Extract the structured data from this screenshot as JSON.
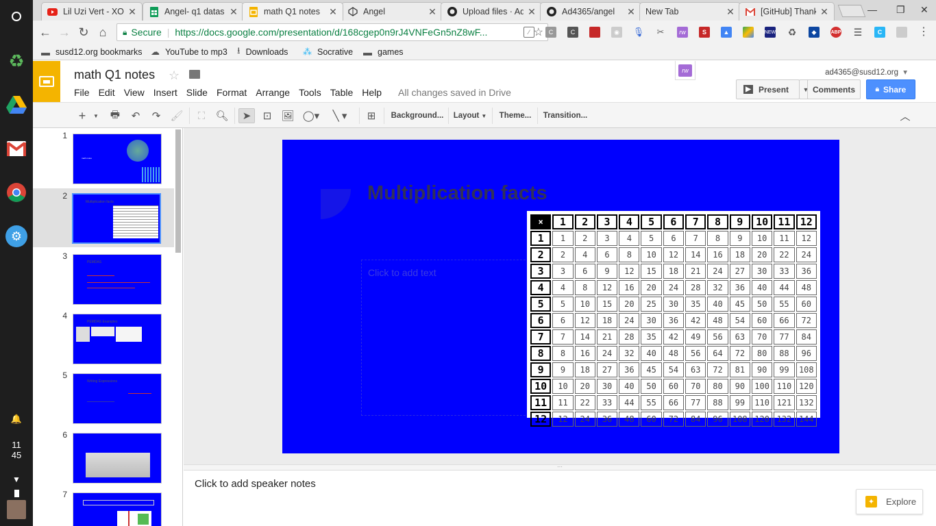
{
  "browser": {
    "tabs": [
      {
        "title": "Lil Uzi Vert - XO",
        "icon": "youtube-icon",
        "active": false
      },
      {
        "title": "Angel- q1 datas",
        "icon": "sheets-icon",
        "active": false
      },
      {
        "title": "math Q1 notes",
        "icon": "slides-icon",
        "active": true
      },
      {
        "title": "Angel",
        "icon": "codepen-icon",
        "active": false
      },
      {
        "title": "Upload files · Ad",
        "icon": "github-icon",
        "active": false
      },
      {
        "title": "Ad4365/angel",
        "icon": "github-icon",
        "active": false
      },
      {
        "title": "New Tab",
        "icon": "",
        "active": false
      },
      {
        "title": "[GitHub] Thanks",
        "icon": "gmail-icon",
        "active": false
      }
    ],
    "secure_label": "Secure",
    "url": "https://docs.google.com/presentation/d/168cgep0n9rJ4VNFeGn5nZ8wF...",
    "bookmarks": [
      {
        "label": "susd12.org bookmarks",
        "icon": "folder-icon"
      },
      {
        "label": "YouTube to mp3",
        "icon": "cloud-download-icon"
      },
      {
        "label": "Downloads",
        "icon": "download-icon"
      },
      {
        "label": "Socrative",
        "icon": "socrative-icon"
      },
      {
        "label": "games",
        "icon": "folder-icon"
      }
    ],
    "extensions": [
      "color-picker",
      "c-gray",
      "c-dark",
      "red-book",
      "camera",
      "mic",
      "scissors",
      "rw",
      "s-red",
      "drive-multi",
      "colors-stripe",
      "new-badge",
      "recycle",
      "shield-blue",
      "abp",
      "list",
      "c-blue",
      "puzzle-gray"
    ]
  },
  "shelf": {
    "clock_hour": "11",
    "clock_min": "45"
  },
  "docs": {
    "title": "math Q1 notes",
    "menu": [
      "File",
      "Edit",
      "View",
      "Insert",
      "Slide",
      "Format",
      "Arrange",
      "Tools",
      "Table",
      "Help"
    ],
    "save_status": "All changes saved in Drive",
    "user_email": "ad4365@susd12.org",
    "present_label": "Present",
    "comments_label": "Comments",
    "share_label": "Share",
    "rw_label": "rw",
    "toolbar": {
      "background_label": "Background...",
      "layout_label": "Layout",
      "theme_label": "Theme...",
      "transition_label": "Transition..."
    }
  },
  "filmstrip": {
    "slides": [
      {
        "num": "1",
        "title": "math notes"
      },
      {
        "num": "2",
        "title": "Multiplication facts"
      },
      {
        "num": "3",
        "title": "PEMDAS"
      },
      {
        "num": "4",
        "title": "PEMDAS Examples"
      },
      {
        "num": "5",
        "title": "Writing Expressions"
      },
      {
        "num": "6",
        "title": ""
      },
      {
        "num": "7",
        "title": ""
      }
    ],
    "active_index": 1
  },
  "slide": {
    "title": "Multiplication facts",
    "body_placeholder": "Click to add text",
    "background_color": "#0000fe",
    "table": {
      "corner": "×",
      "headers": [
        "1",
        "2",
        "3",
        "4",
        "5",
        "6",
        "7",
        "8",
        "9",
        "10",
        "11",
        "12"
      ]
    }
  },
  "notes": {
    "placeholder": "Click to add speaker notes"
  },
  "explore_label": "Explore"
}
